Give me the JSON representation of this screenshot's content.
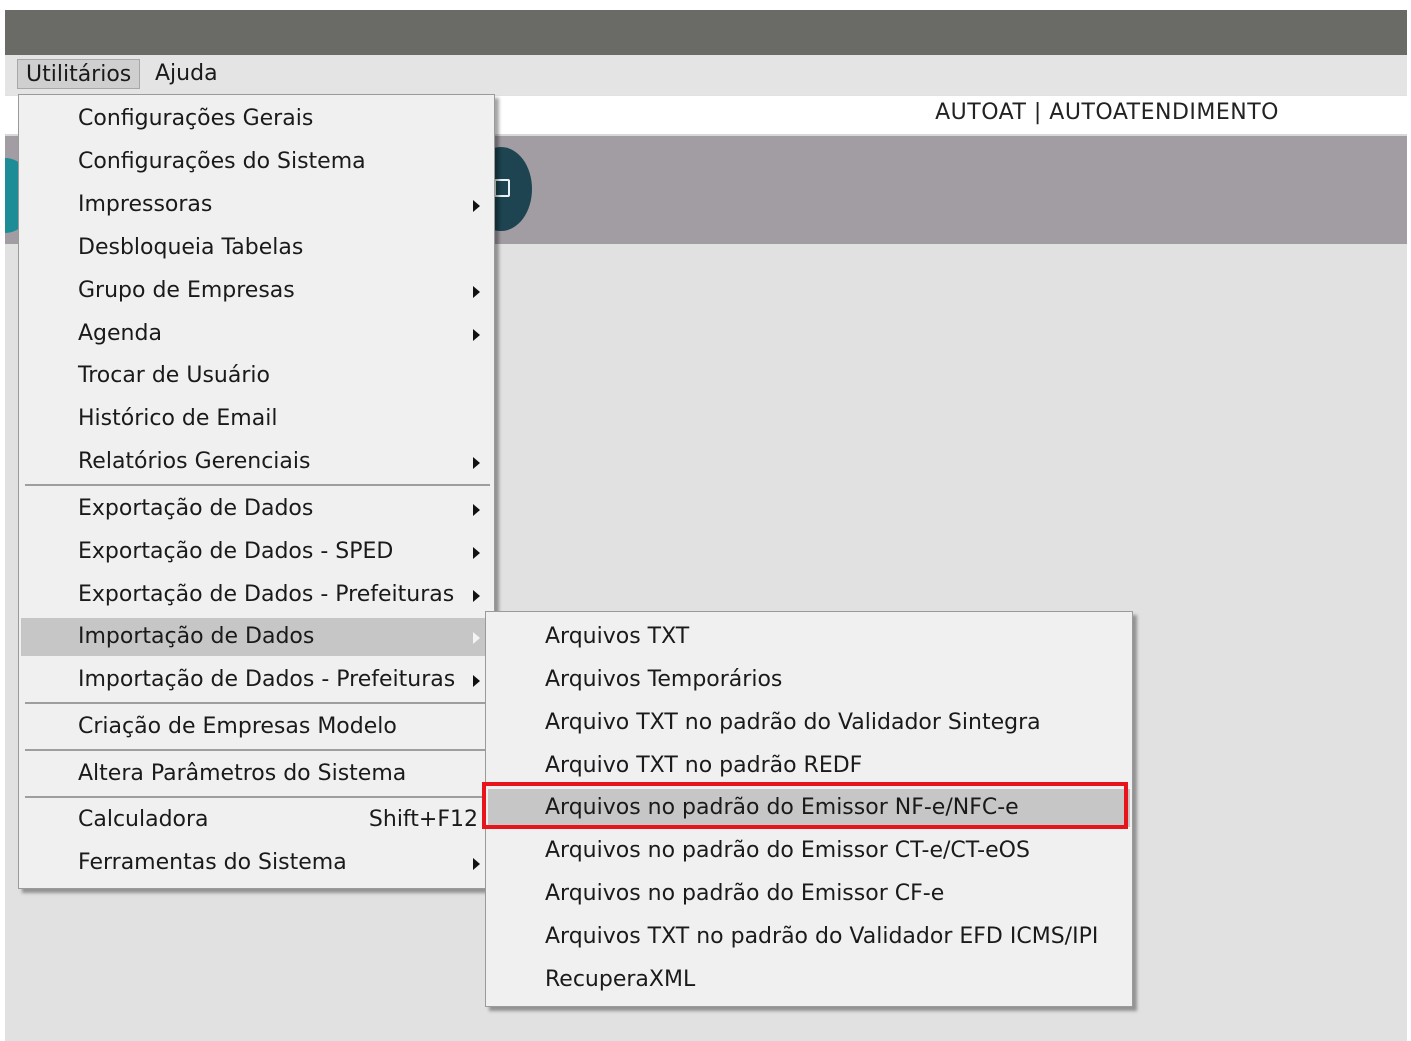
{
  "menubar": {
    "items": [
      {
        "label": "Utilitários"
      },
      {
        "label": "Ajuda"
      }
    ]
  },
  "infobar": {
    "text": "AUTOAT | AUTOATENDIMENTO"
  },
  "main_menu": {
    "items": [
      {
        "label": "Configurações Gerais"
      },
      {
        "label": "Configurações do Sistema"
      },
      {
        "label": "Impressoras"
      },
      {
        "label": "Desbloqueia Tabelas"
      },
      {
        "label": "Grupo de Empresas"
      },
      {
        "label": "Agenda"
      },
      {
        "label": "Trocar de Usuário"
      },
      {
        "label": "Histórico de Email"
      },
      {
        "label": "Relatórios Gerenciais"
      },
      {
        "label": "Exportação de Dados"
      },
      {
        "label": "Exportação de Dados - SPED"
      },
      {
        "label": "Exportação de Dados - Prefeituras"
      },
      {
        "label": "Importação de Dados"
      },
      {
        "label": "Importação de Dados - Prefeituras"
      },
      {
        "label": "Criação de Empresas Modelo"
      },
      {
        "label": "Altera Parâmetros do Sistema"
      },
      {
        "label": "Calculadora",
        "shortcut": "Shift+F12"
      },
      {
        "label": "Ferramentas do Sistema"
      }
    ]
  },
  "sub_menu": {
    "items": [
      {
        "label": "Arquivos TXT"
      },
      {
        "label": "Arquivos Temporários"
      },
      {
        "label": "Arquivo TXT no padrão do Validador Sintegra"
      },
      {
        "label": "Arquivo TXT no padrão REDF"
      },
      {
        "label": "Arquivos no padrão do Emissor NF-e/NFC-e"
      },
      {
        "label": "Arquivos no padrão do Emissor CT-e/CT-eOS"
      },
      {
        "label": "Arquivos no padrão do Emissor CF-e"
      },
      {
        "label": "Arquivos TXT no padrão do Validador EFD ICMS/IPI"
      },
      {
        "label": "RecuperaXML"
      }
    ]
  },
  "colors": {
    "highlight_box": "#e8141c",
    "titlebar": "#6a6a66",
    "toolbar_band": "#a19da3"
  }
}
